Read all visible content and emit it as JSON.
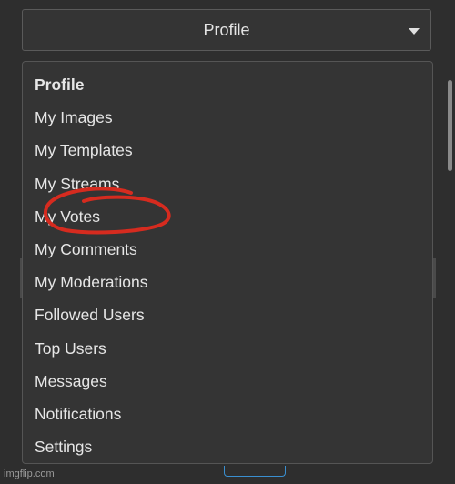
{
  "profile_select": {
    "selected": "Profile"
  },
  "menu": {
    "header": "Profile",
    "items": [
      "My Images",
      "My Templates",
      "My Streams",
      "My Votes",
      "My Comments",
      "My Moderations",
      "Followed Users",
      "Top Users",
      "Messages",
      "Notifications",
      "Settings"
    ]
  },
  "watermark": "imgflip.com",
  "colors": {
    "background": "#2e2e2e",
    "menu_background": "#343434",
    "text": "#e6e6e6",
    "annotation": "#d62b1f",
    "accent_button": "#3a8fd0"
  },
  "icons": {
    "select_caret": "caret-down-icon"
  }
}
